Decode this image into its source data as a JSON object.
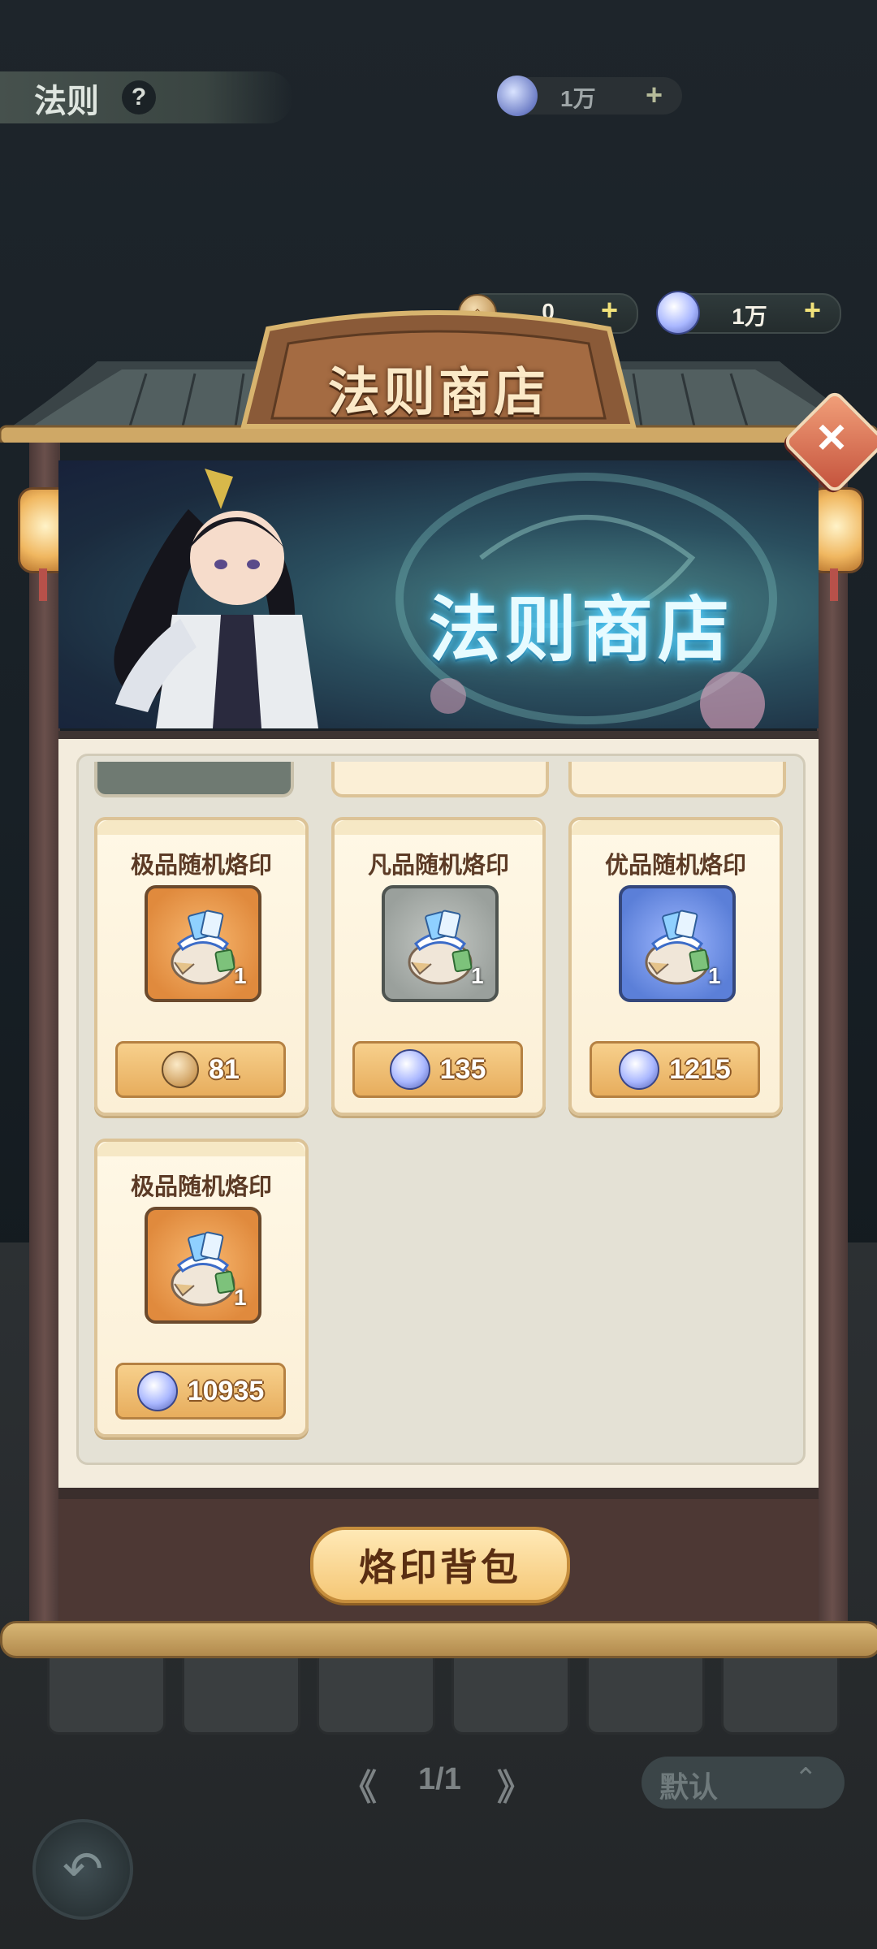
{
  "background": {
    "title": "法则",
    "help_label": "?",
    "currency_value": "1万",
    "currency_plus": "+",
    "pagination": "1/1",
    "sort_label": "默认",
    "sort_chevron": "⌃",
    "back_icon": "↶",
    "prev_icon": "《",
    "next_icon": "》"
  },
  "shop": {
    "title": "法则商店",
    "banner_title": "法则商店",
    "close_label": "×",
    "bag_button": "烙印背包",
    "currencies": [
      {
        "icon": "law-token-icon",
        "value": "0",
        "plus": "+"
      },
      {
        "icon": "swirl-coin-icon",
        "value": "1万",
        "plus": "+"
      }
    ],
    "items": [
      {
        "name": "极品随机烙印",
        "quality": "gold",
        "qty": "1",
        "price": "81",
        "currency": "law-token-icon"
      },
      {
        "name": "凡品随机烙印",
        "quality": "gray",
        "qty": "1",
        "price": "135",
        "currency": "swirl-coin-icon"
      },
      {
        "name": "优品随机烙印",
        "quality": "blue",
        "qty": "1",
        "price": "1215",
        "currency": "swirl-coin-icon"
      },
      {
        "name": "极品随机烙印",
        "quality": "gold",
        "qty": "1",
        "price": "10935",
        "currency": "swirl-coin-icon"
      }
    ]
  },
  "colors": {
    "frame_wood": "#4d3834",
    "accent_gold": "#f5c776",
    "quality_gold": "#e08a3d",
    "quality_gray": "#9aa09c",
    "quality_blue": "#5b7fd8"
  }
}
